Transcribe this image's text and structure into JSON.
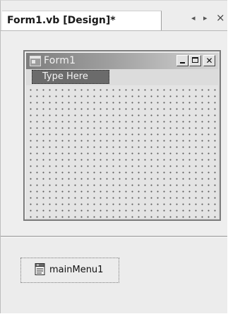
{
  "tab": {
    "title": "Form1.vb [Design]*",
    "nav_left": "◂",
    "nav_right": "▸",
    "close": "×"
  },
  "form": {
    "title": "Form1",
    "controls": {
      "close_glyph": "✕"
    },
    "menu": {
      "placeholder": "Type Here"
    }
  },
  "tray": {
    "components": [
      {
        "label": "mainMenu1",
        "icon": "main-menu-component-icon"
      }
    ]
  }
}
